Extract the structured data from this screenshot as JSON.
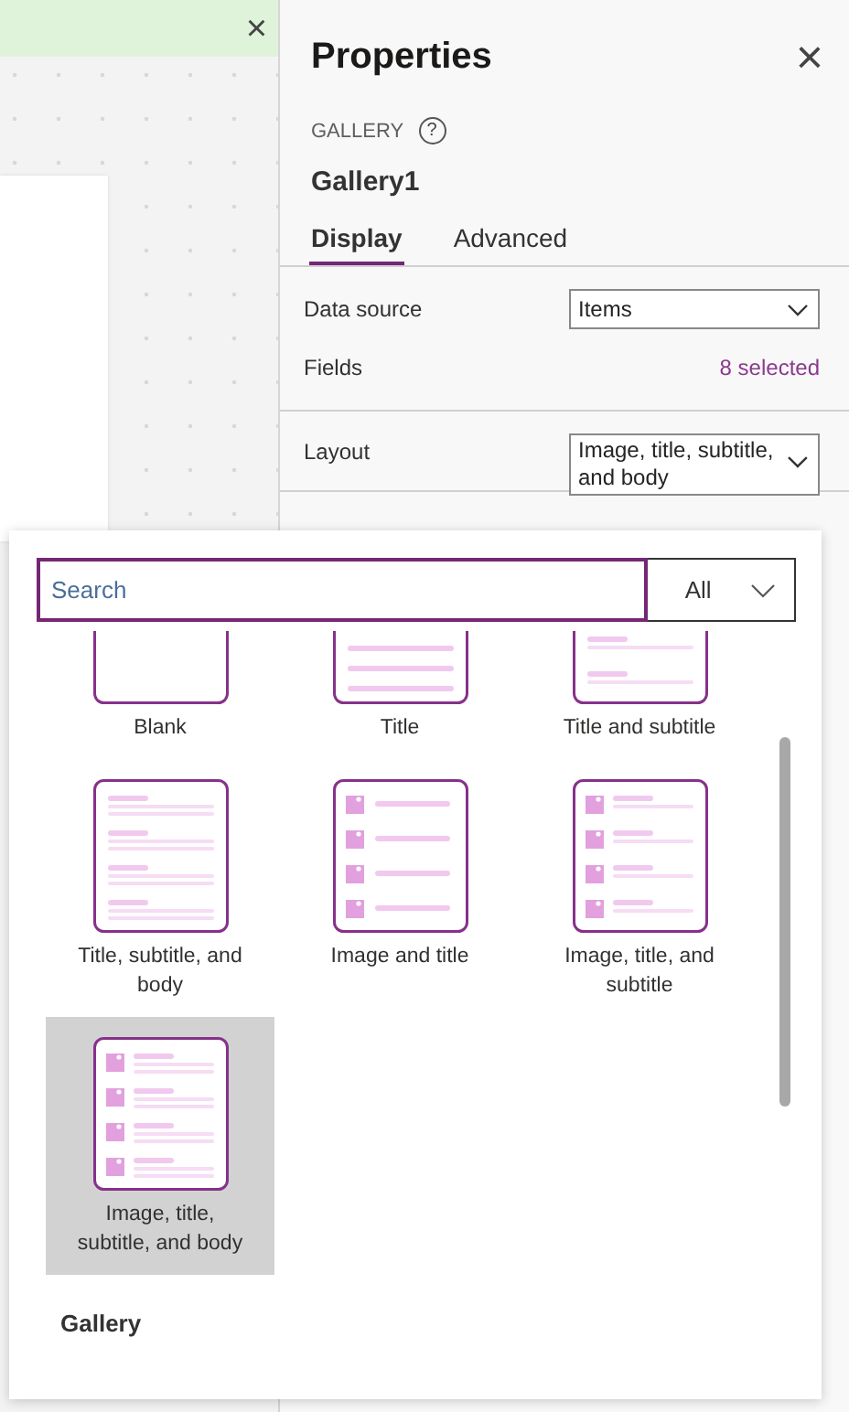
{
  "notification": {
    "close": "×"
  },
  "properties": {
    "title": "Properties",
    "close": "×",
    "control_type": "GALLERY",
    "help": "?",
    "control_name": "Gallery1",
    "tabs": [
      {
        "label": "Display",
        "selected": true
      },
      {
        "label": "Advanced",
        "selected": false
      }
    ],
    "data_source": {
      "label": "Data source",
      "value": "Items"
    },
    "fields": {
      "label": "Fields",
      "value": "8 selected"
    },
    "layout": {
      "label": "Layout",
      "value": "Image, title, subtitle, and body"
    }
  },
  "layout_picker": {
    "search": {
      "placeholder": "Search"
    },
    "filter": {
      "value": "All"
    },
    "tiles": [
      {
        "kind": "blank",
        "label": "Blank",
        "selected": false
      },
      {
        "kind": "title",
        "label": "Title",
        "selected": false
      },
      {
        "kind": "title-subtitle",
        "label": "Title and subtitle",
        "selected": false
      },
      {
        "kind": "title-subtitle-body",
        "label": "Title, subtitle, and body",
        "selected": false
      },
      {
        "kind": "image-title",
        "label": "Image and title",
        "selected": false
      },
      {
        "kind": "image-title-subtitle",
        "label": "Image, title, and subtitle",
        "selected": false
      },
      {
        "kind": "image-title-subtitle-body",
        "label": "Image, title, subtitle, and body",
        "selected": true
      }
    ],
    "section": "Gallery"
  }
}
